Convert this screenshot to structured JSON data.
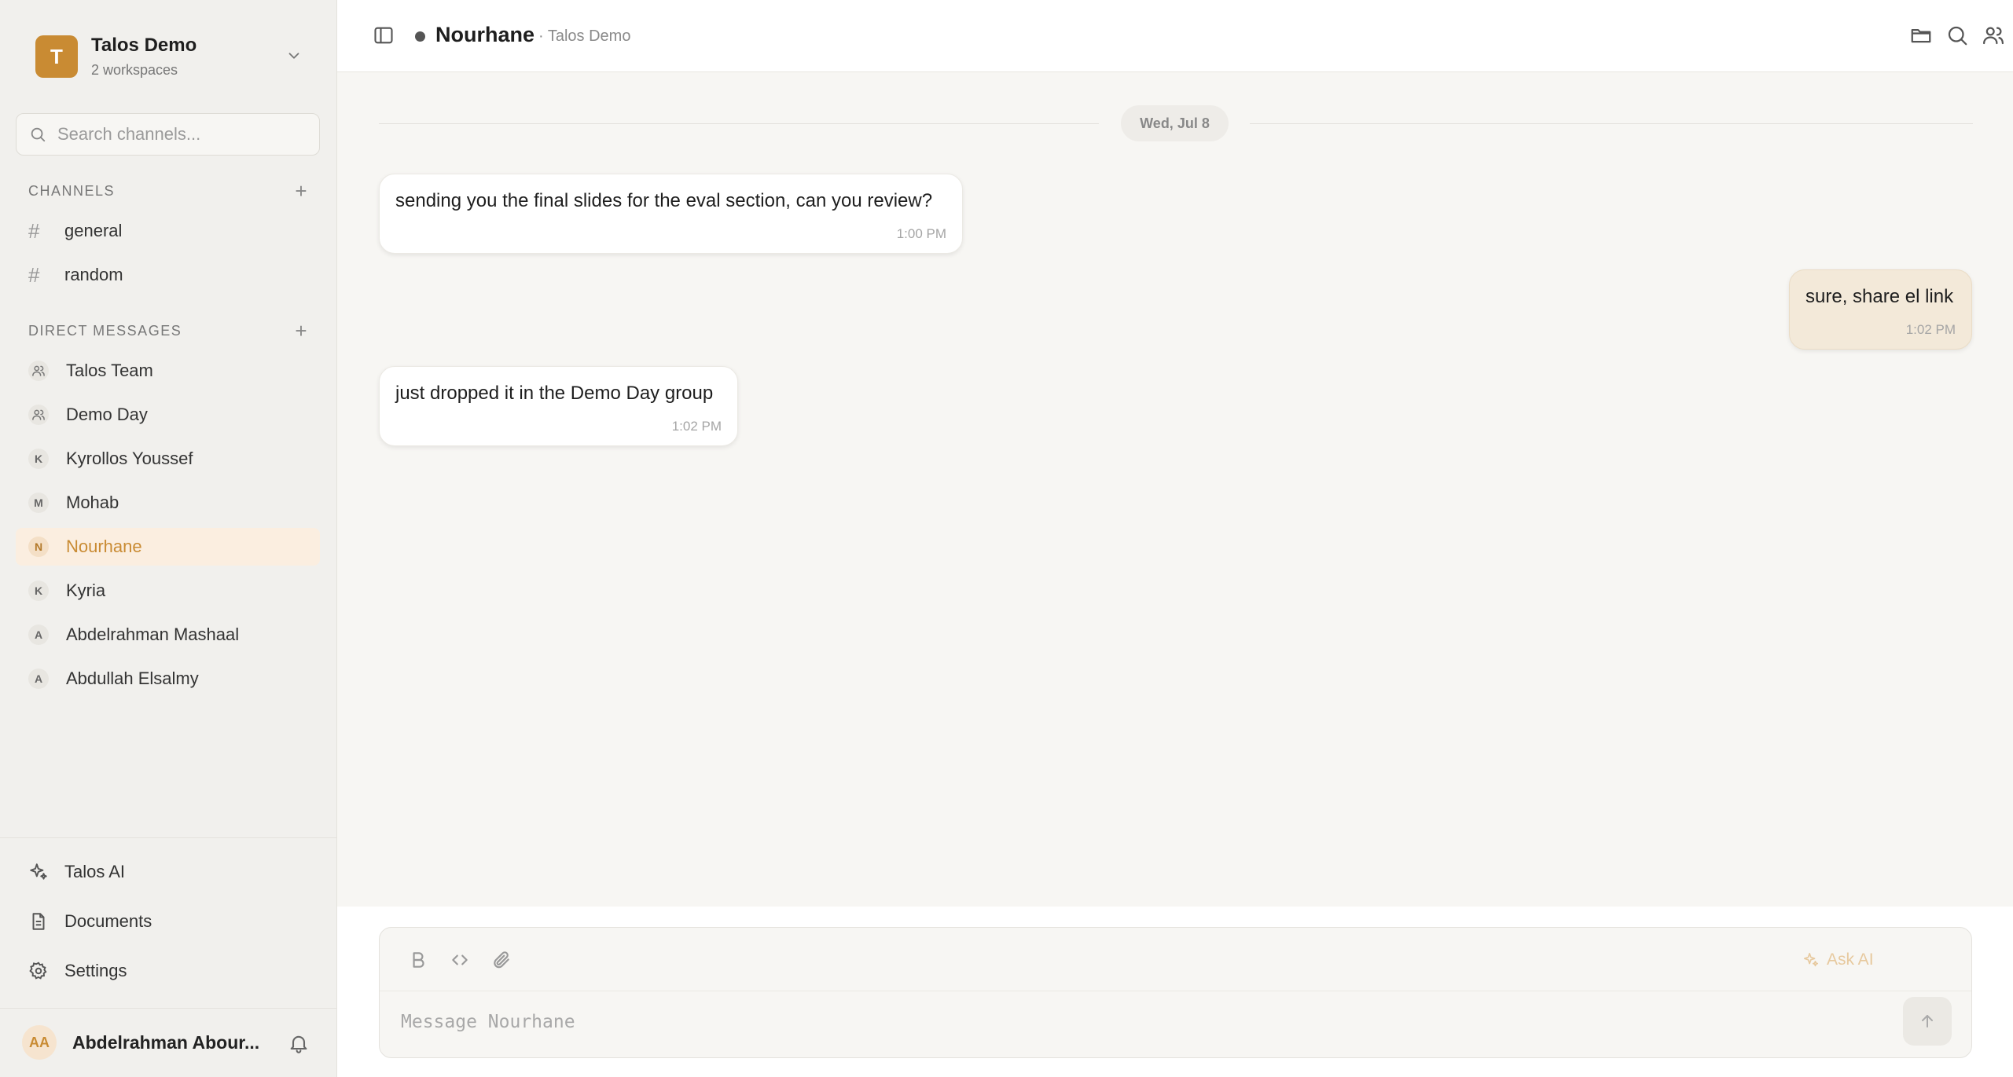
{
  "workspace": {
    "logo_letter": "T",
    "name": "Talos Demo",
    "subtitle": "2 workspaces"
  },
  "search": {
    "placeholder": "Search channels..."
  },
  "channels": {
    "heading": "CHANNELS",
    "items": [
      {
        "label": "general"
      },
      {
        "label": "random"
      }
    ]
  },
  "direct_messages": {
    "heading": "DIRECT MESSAGES",
    "items": [
      {
        "label": "Talos Team",
        "avatar": "group-icon"
      },
      {
        "label": "Demo Day",
        "avatar": "group-icon"
      },
      {
        "label": "Kyrollos Youssef",
        "initial": "K"
      },
      {
        "label": "Mohab",
        "initial": "M"
      },
      {
        "label": "Nourhane",
        "initial": "N",
        "active": true
      },
      {
        "label": "Kyria",
        "initial": "K"
      },
      {
        "label": "Abdelrahman Mashaal",
        "initial": "A"
      },
      {
        "label": "Abdullah Elsalmy",
        "initial": "A"
      }
    ]
  },
  "tools": {
    "ai": "Talos AI",
    "documents": "Documents",
    "settings": "Settings"
  },
  "user": {
    "initials": "AA",
    "name": "Abdelrahman Abour..."
  },
  "header": {
    "title": "Nourhane",
    "subtitle": "· Talos Demo"
  },
  "conversation": {
    "date": "Wed, Jul 8",
    "messages": [
      {
        "text": "sending you the final slides for the eval section, can you review?",
        "time": "1:00 PM",
        "from": "other"
      },
      {
        "text": "sure, share el link",
        "time": "1:02 PM",
        "from": "me"
      },
      {
        "text": "just dropped it in the Demo Day group",
        "time": "1:02 PM",
        "from": "other"
      }
    ]
  },
  "composer": {
    "placeholder": "Message Nourhane",
    "ask_ai": "Ask AI"
  },
  "colors": {
    "accent": "#c98b33",
    "active_bg": "#fbeee0",
    "my_bubble": "#f3e9d9"
  }
}
